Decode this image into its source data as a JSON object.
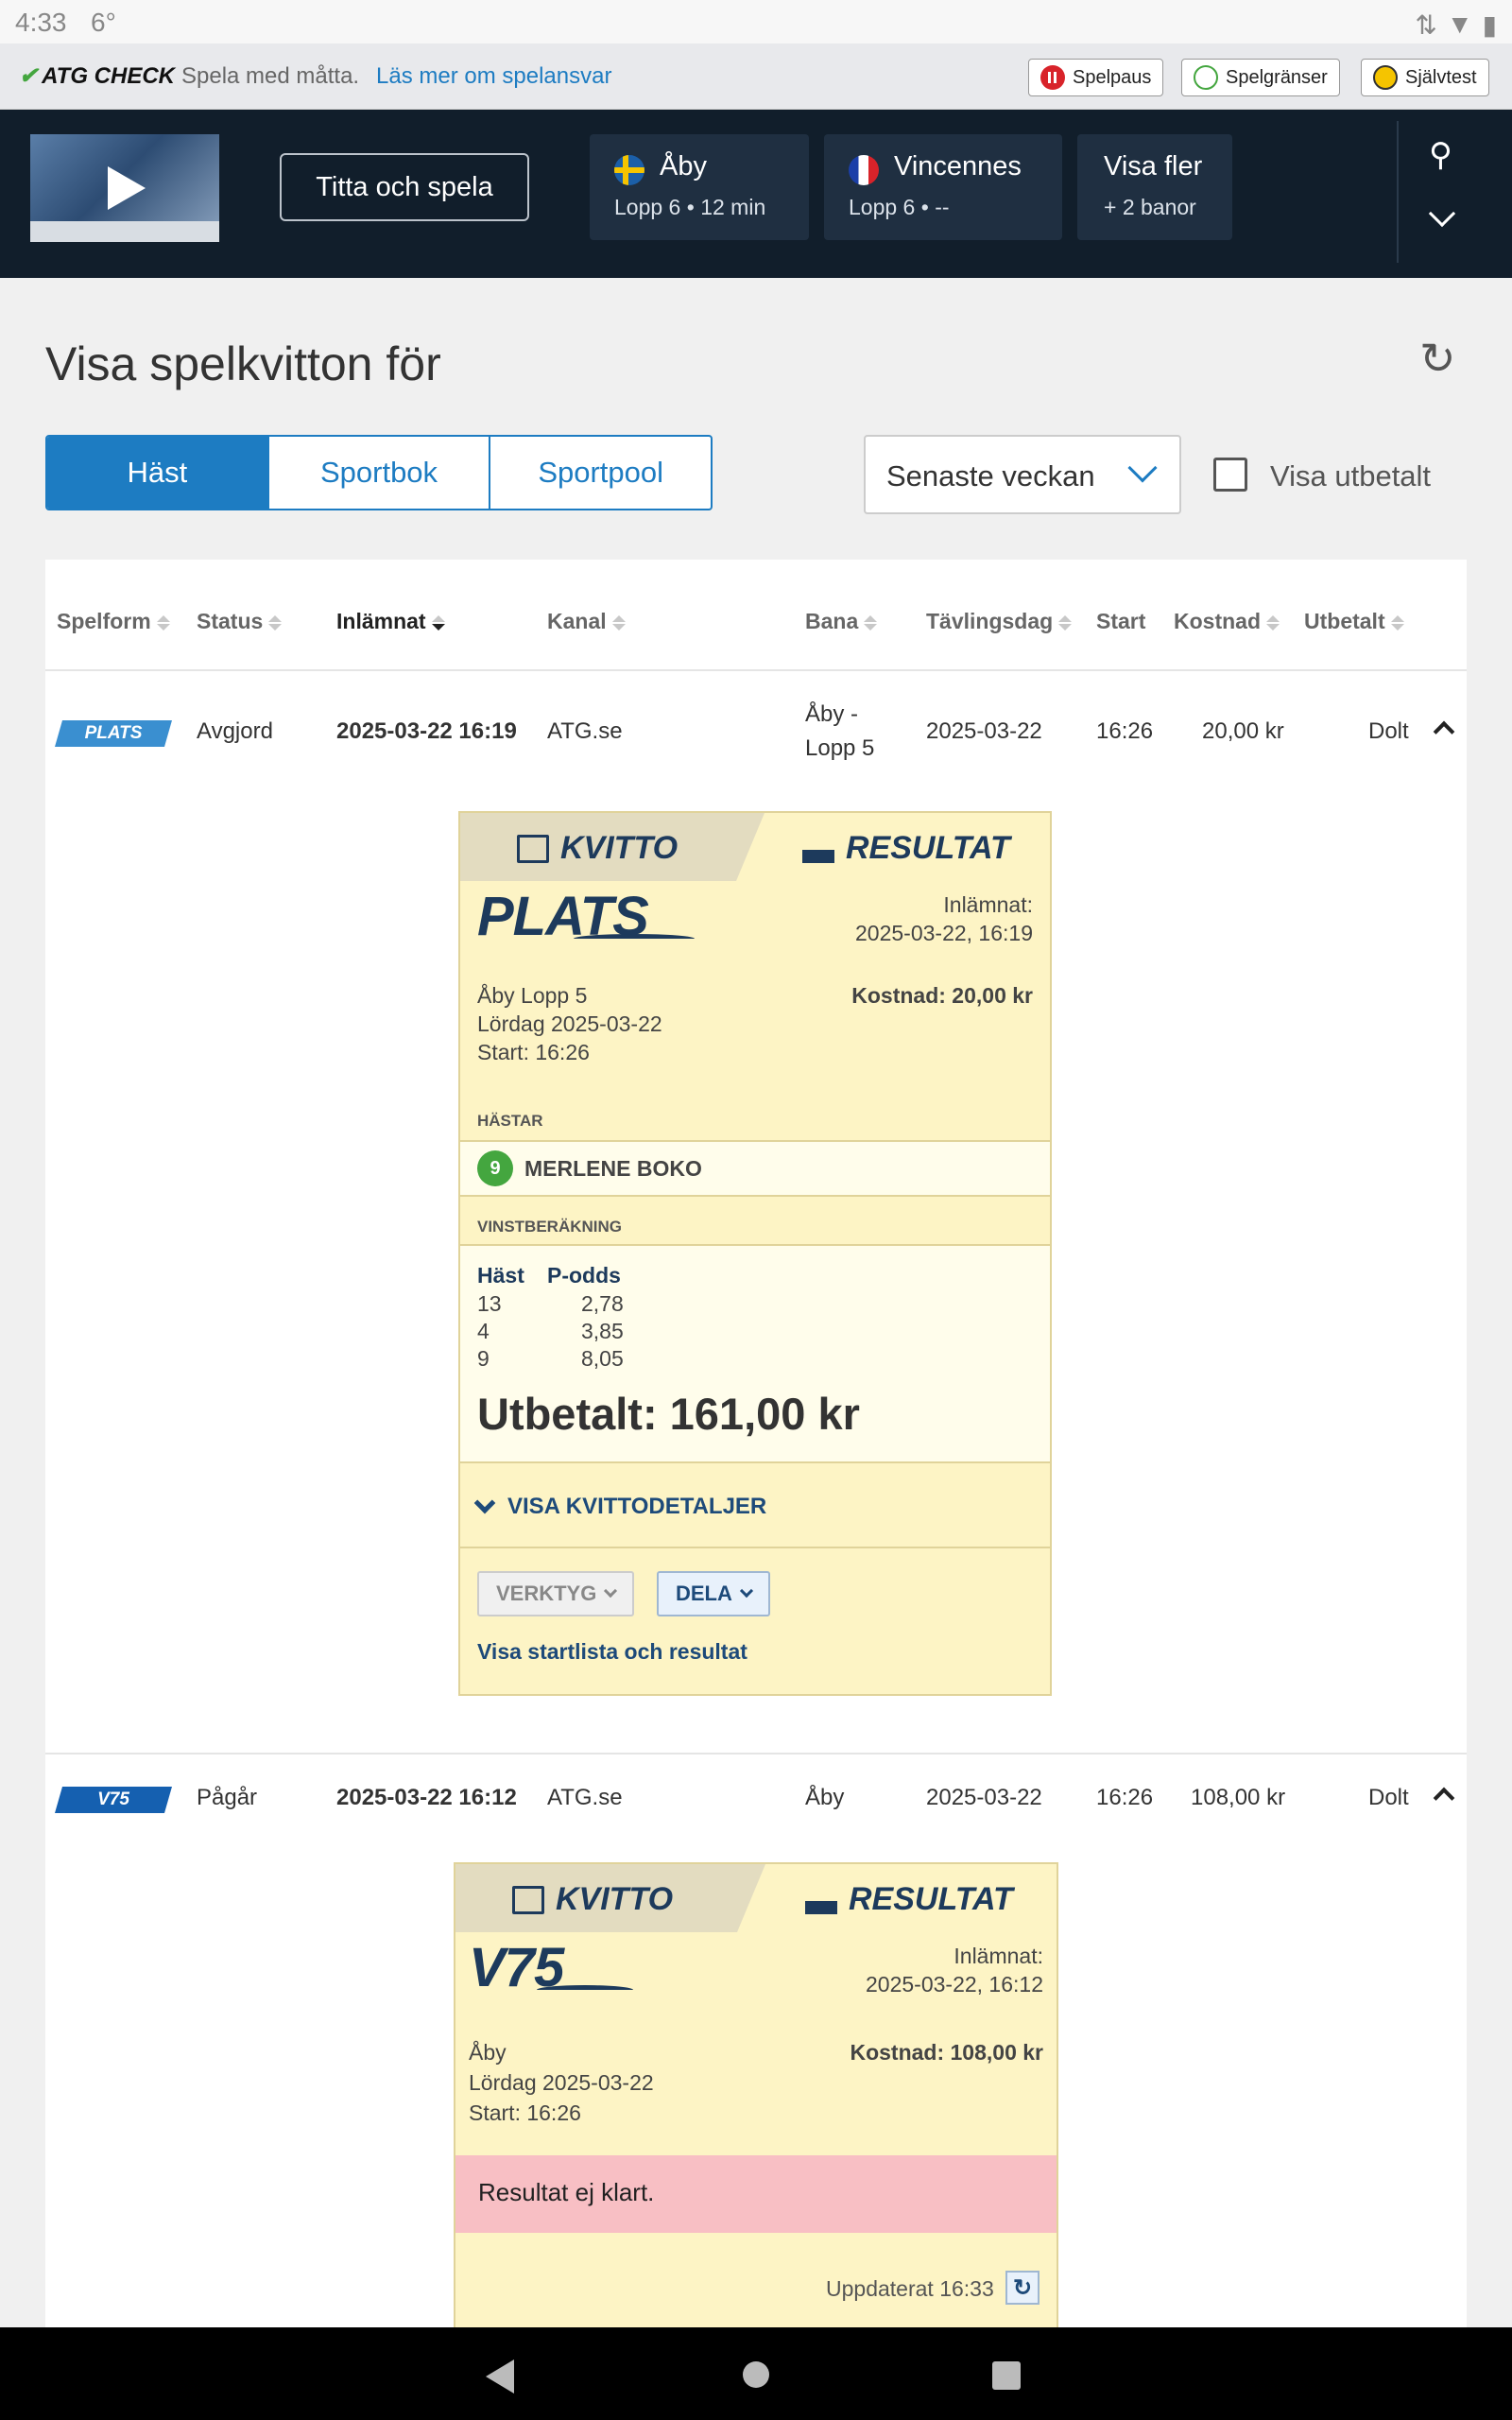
{
  "status_bar": {
    "time": "4:33",
    "temp": "6°"
  },
  "responsible": {
    "logo": "ATG CHECK",
    "message": "Spela med måtta.",
    "link": "Läs mer om spelansvar",
    "buttons": [
      "Spelpaus",
      "Spelgränser",
      "Självtest"
    ]
  },
  "nav": {
    "watch_label": "Titta och spela",
    "tracks": [
      {
        "name": "Åby",
        "race": "Lopp 6",
        "time": "12 min"
      },
      {
        "name": "Vincennes",
        "race": "Lopp 6",
        "time": "--"
      }
    ],
    "more_label": "Visa fler",
    "more_sub": "+ 2 banor"
  },
  "page_title": "Visa spelkvitton för",
  "tabs": [
    "Häst",
    "Sportbok",
    "Sportpool"
  ],
  "period_select": "Senaste veckan",
  "paid_checkbox_label": "Visa utbetalt",
  "table": {
    "headers": [
      "Spelform",
      "Status",
      "Inlämnat",
      "Kanal",
      "Bana",
      "Tävlingsdag",
      "Start",
      "Kostnad",
      "Utbetalt"
    ],
    "rows": [
      {
        "game": "PLATS",
        "status": "Avgjord",
        "submitted": "2025-03-22 16:19",
        "channel": "ATG.se",
        "track_line1": "Åby -",
        "track_line2": "Lopp 5",
        "date": "2025-03-22",
        "start": "16:26",
        "cost": "20,00 kr",
        "paid": "Dolt"
      },
      {
        "game": "V75",
        "status": "Pågår",
        "submitted": "2025-03-22 16:12",
        "channel": "ATG.se",
        "track_line1": "Åby",
        "date": "2025-03-22",
        "start": "16:26",
        "cost": "108,00 kr",
        "paid": "Dolt"
      }
    ]
  },
  "receipt1": {
    "tab_kvitto": "KVITTO",
    "tab_resultat": "RESULTAT",
    "logo": "PLATS",
    "submitted_label": "Inlämnat:",
    "submitted_value": "2025-03-22, 16:19",
    "race": "Åby Lopp 5",
    "day": "Lördag 2025-03-22",
    "start": "Start: 16:26",
    "cost": "Kostnad: 20,00 kr",
    "horses_label": "HÄSTAR",
    "horse_number": "9",
    "horse_name": "MERLENE BOKO",
    "calc_label": "VINSTBERÄKNING",
    "calc_headers": [
      "Häst",
      "P-odds"
    ],
    "calc_rows": [
      [
        "13",
        "2,78"
      ],
      [
        "4",
        "3,85"
      ],
      [
        "9",
        "8,05"
      ]
    ],
    "payout": "Utbetalt: 161,00 kr",
    "details_link": "VISA KVITTODETALJER",
    "tools": "VERKTYG",
    "share": "DELA",
    "startlist_link": "Visa startlista och resultat"
  },
  "receipt2": {
    "tab_kvitto": "KVITTO",
    "tab_resultat": "RESULTAT",
    "logo": "V75",
    "submitted_label": "Inlämnat:",
    "submitted_value": "2025-03-22, 16:12",
    "race": "Åby",
    "day": "Lördag 2025-03-22",
    "start": "Start: 16:26",
    "cost": "Kostnad: 108,00 kr",
    "result_msg": "Resultat ej klart.",
    "updated": "Uppdaterat 16:33"
  },
  "colors": {
    "accent": "#1d7cc2",
    "nav_bg": "#111e2b",
    "receipt_bg": "#fdf4c5",
    "plats_badge": "#3a8fd0",
    "v75_badge": "#1560b0"
  }
}
